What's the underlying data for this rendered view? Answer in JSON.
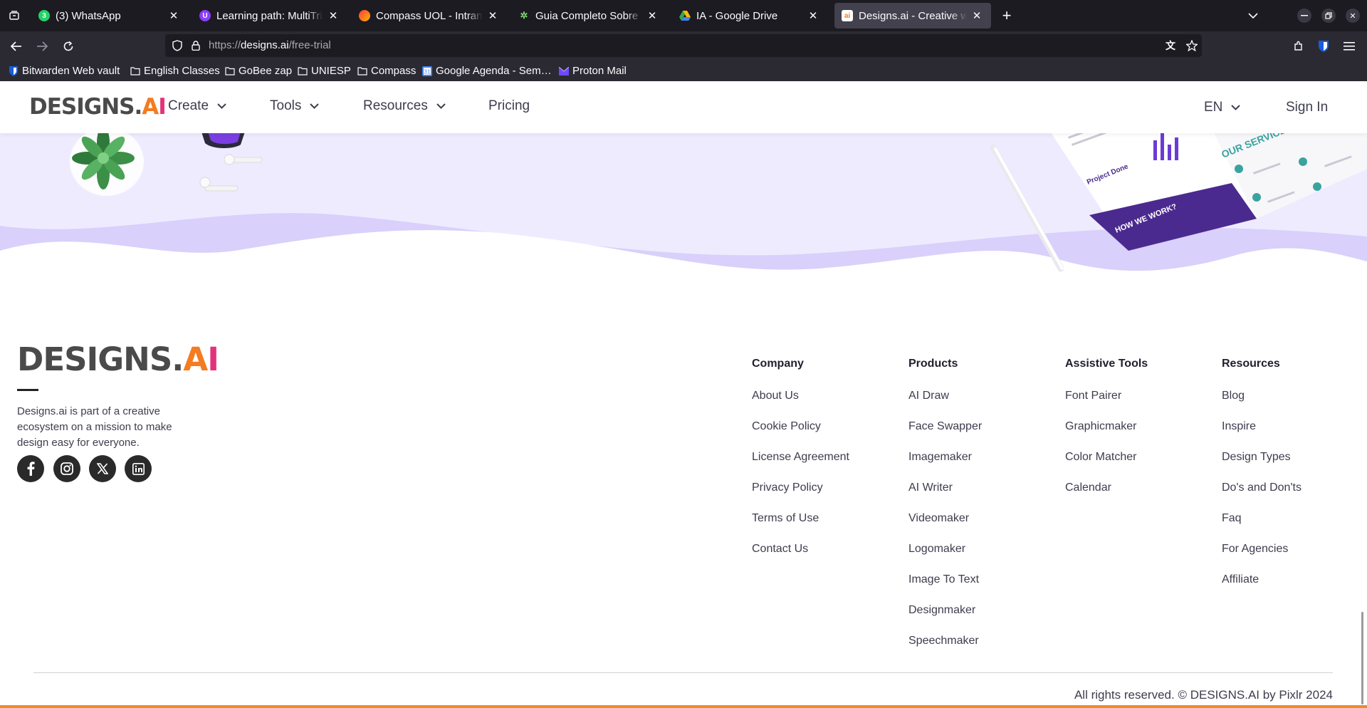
{
  "browser": {
    "tabs": [
      {
        "label": "(3) WhatsApp",
        "favicon": "whatsapp-icon",
        "active": false
      },
      {
        "label": "Learning path: MultiTrilhas",
        "favicon": "learning-icon",
        "active": false
      },
      {
        "label": "Compass UOL - Intranet",
        "favicon": "compass-icon",
        "active": false
      },
      {
        "label": "Guia Completo Sobre Inteligência",
        "favicon": "guia-icon",
        "active": false
      },
      {
        "label": "IA - Google Drive",
        "favicon": "google-drive-icon",
        "active": false
      },
      {
        "label": "Designs.ai - Creative work",
        "favicon": "designs-ai-icon",
        "active": true
      }
    ],
    "url": {
      "prefix": "https://",
      "host": "designs.ai",
      "path": "/free-trial"
    },
    "bookmarks": [
      {
        "label": "Bitwarden Web vault",
        "icon": "bitwarden-icon"
      },
      {
        "label": "English Classes",
        "icon": "folder-icon"
      },
      {
        "label": "GoBee zap",
        "icon": "folder-icon"
      },
      {
        "label": "UNIESP",
        "icon": "folder-icon"
      },
      {
        "label": "Compass",
        "icon": "folder-icon"
      },
      {
        "label": "Google Agenda - Sem…",
        "icon": "google-calendar-icon"
      },
      {
        "label": "Proton Mail",
        "icon": "proton-mail-icon"
      }
    ]
  },
  "site": {
    "logo_text": "DESIGNS.",
    "logo_ai": "AI",
    "nav": {
      "create": "Create",
      "tools": "Tools",
      "resources": "Resources",
      "pricing": "Pricing",
      "language": "EN",
      "sign_in": "Sign In"
    },
    "hero": {
      "brochure_heading_1": "Project Done",
      "brochure_heading_2": "HOW WE WORK?",
      "brochure_heading_3": "OUR SERVICES"
    },
    "footer": {
      "about": "Designs.ai is part of a creative ecosystem on a mission to make design easy for everyone.",
      "social": [
        "facebook-icon",
        "instagram-icon",
        "x-icon",
        "linkedin-icon"
      ],
      "columns": [
        {
          "title": "Company",
          "links": [
            "About Us",
            "Cookie Policy",
            "License Agreement",
            "Privacy Policy",
            "Terms of Use",
            "Contact Us"
          ]
        },
        {
          "title": "Products",
          "links": [
            "AI Draw",
            "Face Swapper",
            "Imagemaker",
            "AI Writer",
            "Videomaker",
            "Logomaker",
            "Image To Text",
            "Designmaker",
            "Speechmaker"
          ]
        },
        {
          "title": "Assistive Tools",
          "links": [
            "Font Pairer",
            "Graphicmaker",
            "Color Matcher",
            "Calendar"
          ]
        },
        {
          "title": "Resources",
          "links": [
            "Blog",
            "Inspire",
            "Design Types",
            "Do's and Don'ts",
            "Faq",
            "For Agencies",
            "Affiliate"
          ]
        }
      ],
      "copyright": "All rights reserved. © DESIGNS.AI by Pixlr 2024"
    },
    "colors": {
      "hero_bg": "#efebff",
      "wave": "#d9d0fb",
      "accent_bar": "#f08a2a",
      "brochure_purple": "#4b2a8f"
    }
  }
}
